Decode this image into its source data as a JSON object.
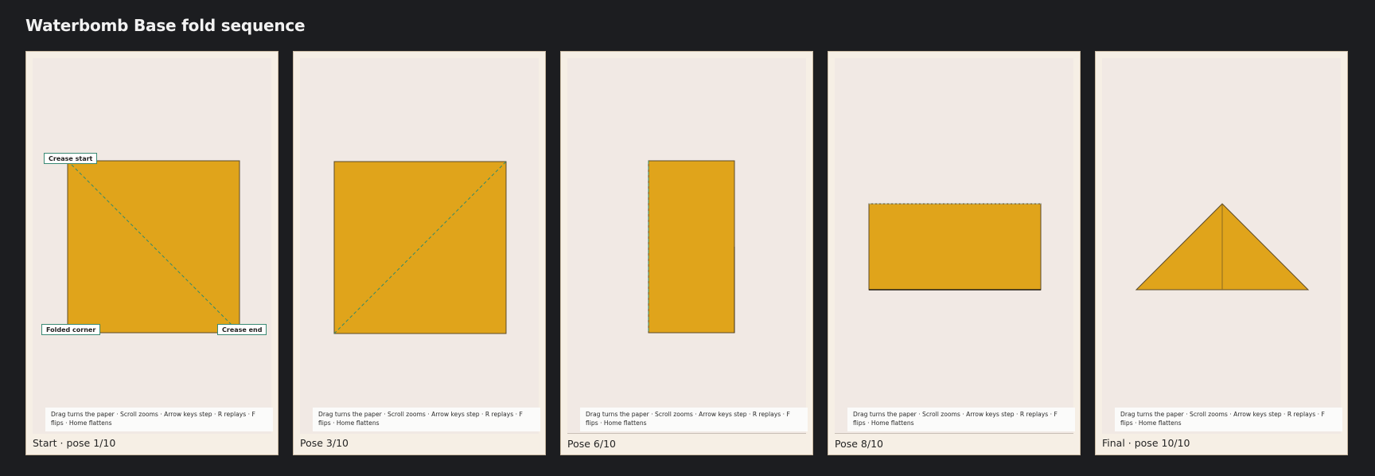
{
  "app_title": "Waterbomb Base fold sequence",
  "hint_text": "Drag turns the paper · Scroll zooms · Arrow keys step · R replays · F flips · Home flattens",
  "colors": {
    "paper": "#e0a41b",
    "crease": "#2e8a6e",
    "background": "#1c1d20",
    "panel": "#f6efe5"
  },
  "callouts": {
    "crease_start": "Crease start",
    "folded_corner": "Folded corner",
    "crease_end": "Crease end"
  },
  "panels": [
    {
      "caption": "Start · pose 1/10"
    },
    {
      "caption": "Pose 3/10"
    },
    {
      "caption": "Pose 6/10"
    },
    {
      "caption": "Pose 8/10"
    },
    {
      "caption": "Final · pose 10/10"
    }
  ]
}
